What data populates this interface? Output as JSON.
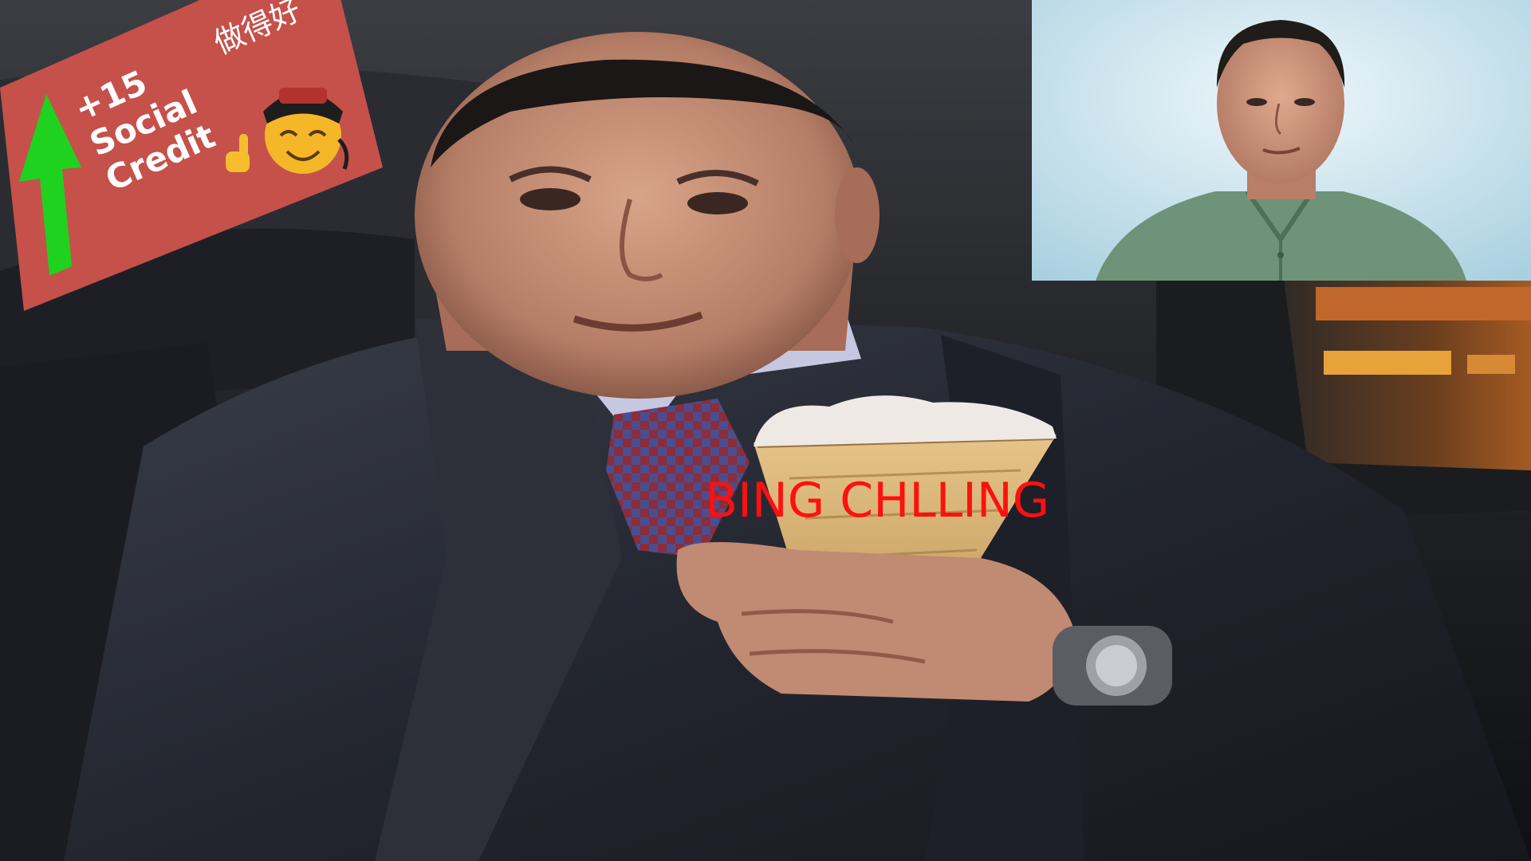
{
  "meme": {
    "caption": "BING CHLLING",
    "colors": {
      "caption": "#ff1010",
      "badge_background": "#c5514a",
      "arrow": "#1fd21f",
      "portrait_background": "#cfe6ef"
    }
  },
  "social_credit_badge": {
    "line1": "+15",
    "line2": "Social",
    "line3": "Credit",
    "chinese": "做得好",
    "icons": [
      "up-arrow-icon",
      "thumbs-up-icon",
      "emperor-face-icon"
    ]
  },
  "portrait_inset": {
    "subject": "man-in-green-tunic"
  }
}
